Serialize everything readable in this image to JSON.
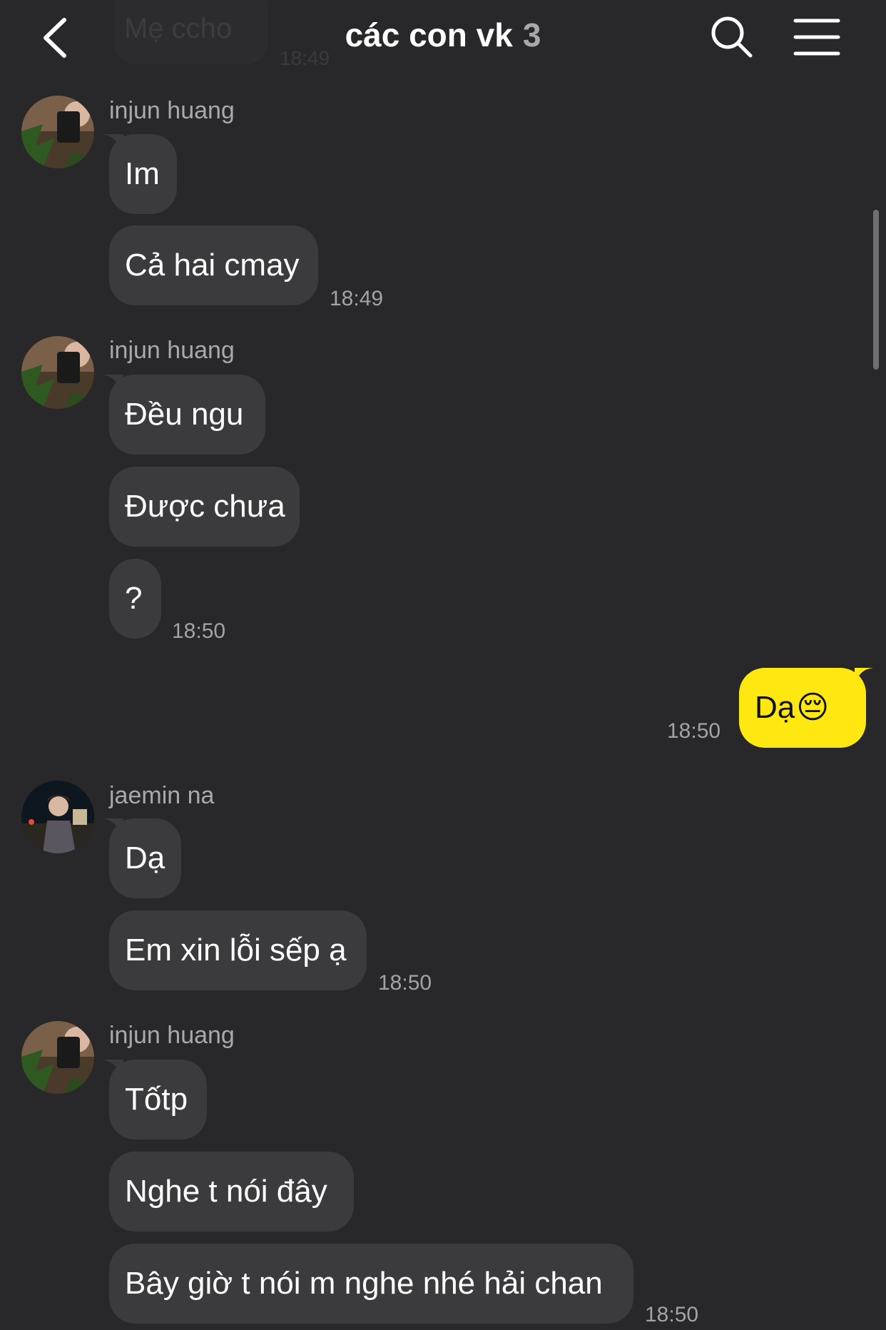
{
  "header": {
    "title": "các con vk",
    "member_count": "3",
    "back_icon": "chevron-left-icon",
    "search_icon": "search-icon",
    "menu_icon": "hamburger-menu-icon",
    "ghost_message": "Mẹ ccho",
    "ghost_time": "18:49"
  },
  "colors": {
    "background": "#28282a",
    "incoming_bubble": "#3b3b3d",
    "outgoing_bubble": "#ffe812",
    "text": "#ffffff",
    "meta": "#a9a9ac"
  },
  "messages": {
    "g1": {
      "sender": "injun huang",
      "bubbles": [
        "Im",
        "Cả hai cmay"
      ],
      "time": "18:49"
    },
    "g2": {
      "sender": "injun huang",
      "bubbles": [
        "Đều ngu",
        "Được chưa",
        "?"
      ],
      "time": "18:50"
    },
    "mine": {
      "text": "Dạ",
      "emoji": "😔",
      "time": "18:50"
    },
    "g3": {
      "sender": "jaemin na",
      "bubbles": [
        "Dạ",
        "Em xin lỗi sếp ạ"
      ],
      "time": "18:50"
    },
    "g4": {
      "sender": "injun huang",
      "bubbles": [
        "Tốtp",
        "Nghe t nói đây",
        "Bây giờ t nói m nghe nhé hải chan"
      ],
      "time": "18:50"
    }
  }
}
